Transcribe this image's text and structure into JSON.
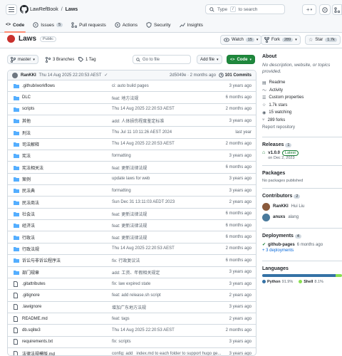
{
  "header": {
    "owner": "LawRefBook",
    "separator": "/",
    "repo": "Laws",
    "search_text": "Type",
    "search_slash": "/",
    "search_suffix": "to search",
    "plus": "+"
  },
  "tabs": [
    {
      "label": "Code"
    },
    {
      "label": "Issues",
      "count": "5"
    },
    {
      "label": "Pull requests"
    },
    {
      "label": "Actions"
    },
    {
      "label": "Security"
    },
    {
      "label": "Insights"
    }
  ],
  "repo_head": {
    "name": "Laws",
    "visibility": "Public",
    "watch_label": "Watch",
    "watch_count": "15",
    "fork_label": "Fork",
    "fork_count": "289",
    "star_label": "Star",
    "star_count": "1.7k"
  },
  "toolbar": {
    "branch": "master",
    "branches": "3 Branches",
    "tags": "1 Tag",
    "go_to_file": "Go to file",
    "add_file": "Add file",
    "code": "Code"
  },
  "commit": {
    "author": "RanKKI",
    "date": "Thu 14 Aug 2025 22:20:53 AEST",
    "check": "✓",
    "sha_time": "2d5049e · 2 months ago",
    "commits": "101 Commits"
  },
  "files": [
    {
      "name": ".github/workflows",
      "type": "dir",
      "msg": "ci: auto build pages",
      "date": "3 years ago"
    },
    {
      "name": "DLC",
      "type": "dir",
      "msg": "feat: 地方法规",
      "date": "6 months ago"
    },
    {
      "name": "scripts",
      "type": "dir",
      "msg": "Thu 14 Aug 2025 22:20:53 AEST",
      "date": "2 months ago"
    },
    {
      "name": "其他",
      "type": "dir",
      "msg": "add: 人体损伤程度鉴定标准",
      "date": "3 years ago"
    },
    {
      "name": "刑法",
      "type": "dir",
      "msg": "Thu Jul 11 10:11:26 AEST 2024",
      "date": "last year"
    },
    {
      "name": "司法解释",
      "type": "dir",
      "msg": "Thu 14 Aug 2025 22:20:53 AEST",
      "date": "2 months ago"
    },
    {
      "name": "宪法",
      "type": "dir",
      "msg": "formatting",
      "date": "3 years ago"
    },
    {
      "name": "宪法相关法",
      "type": "dir",
      "msg": "feat: 更新法律法规",
      "date": "6 months ago"
    },
    {
      "name": "案例",
      "type": "dir",
      "msg": "update laws for web",
      "date": "3 years ago"
    },
    {
      "name": "民法典",
      "type": "dir",
      "msg": "formatting",
      "date": "3 years ago"
    },
    {
      "name": "民法商法",
      "type": "dir",
      "msg": "Sun Dec 31 13:11:03 AEDT 2023",
      "date": "2 years ago"
    },
    {
      "name": "社会法",
      "type": "dir",
      "msg": "feat: 更新法律法规",
      "date": "6 months ago"
    },
    {
      "name": "经济法",
      "type": "dir",
      "msg": "feat: 更新法律法规",
      "date": "6 months ago"
    },
    {
      "name": "行政法",
      "type": "dir",
      "msg": "feat: 更新法律法规",
      "date": "6 months ago"
    },
    {
      "name": "行政法规",
      "type": "dir",
      "msg": "Thu 14 Aug 2025 22:20:53 AEST",
      "date": "2 months ago"
    },
    {
      "name": "诉讼与非诉讼程序法",
      "type": "dir",
      "msg": "fix: 行政复议法",
      "date": "6 months ago"
    },
    {
      "name": "部门规章",
      "type": "dir",
      "msg": "add: 工资、年假相关规定",
      "date": "3 years ago"
    },
    {
      "name": ".gitattributes",
      "type": "file",
      "msg": "fix: law expired state",
      "date": "3 years ago"
    },
    {
      "name": ".gitignore",
      "type": "file",
      "msg": "feat: add release.sh script",
      "date": "2 years ago"
    },
    {
      "name": ".lawignore",
      "type": "file",
      "msg": "增加广东地方法规",
      "date": "3 years ago"
    },
    {
      "name": "README.md",
      "type": "file",
      "msg": "feat: tags",
      "date": "2 years ago"
    },
    {
      "name": "db.sqlite3",
      "type": "file",
      "msg": "Thu 14 Aug 2025 22:20:53 AEST",
      "date": "2 months ago"
    },
    {
      "name": "requirements.txt",
      "type": "file",
      "msg": "fix: scripts",
      "date": "3 years ago"
    },
    {
      "name": "法律法规模版.md",
      "type": "file",
      "msg": "config: add _index.md to each folder to support hugo ge...",
      "date": "3 years ago"
    }
  ],
  "about": {
    "title": "About",
    "desc": "No description, website, or topics provided.",
    "items": [
      "Readme",
      "Activity",
      "Custom properties",
      "1.7k stars",
      "15 watching",
      "289 forks"
    ],
    "report": "Report repository"
  },
  "releases": {
    "title": "Releases",
    "count": "1",
    "tag": "v1.0.0",
    "latest": "Latest",
    "date": "on Dec 2, 2023"
  },
  "packages": {
    "title": "Packages",
    "none": "No packages published"
  },
  "contributors": {
    "title": "Contributors",
    "count": "2",
    "people": [
      {
        "user": "RanKKI",
        "name": "Hui Liu",
        "color": "#8a5a3c"
      },
      {
        "user": "anuxs",
        "name": "alang",
        "color": "#4a7a9c"
      }
    ]
  },
  "deployments": {
    "title": "Deployments",
    "count": "4",
    "env": "github-pages",
    "when": "6 months ago",
    "more": "+ 3 deployments"
  },
  "languages": {
    "title": "Languages",
    "items": [
      {
        "name": "Python",
        "pct": "91.9%",
        "value": 91.9,
        "color": "#3572A5"
      },
      {
        "name": "Shell",
        "pct": "8.1%",
        "value": 8.1,
        "color": "#89e051"
      }
    ]
  }
}
